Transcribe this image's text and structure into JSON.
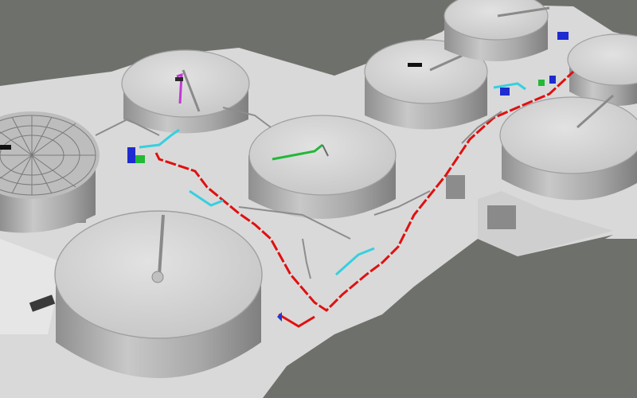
{
  "viewport": {
    "background": "#6e716b",
    "model_fill": "#dcdcdc",
    "tank_wall": "#b8b8b8",
    "tank_top": "#d4d4d4"
  },
  "pipe_colors": {
    "main_pipe": "#e01010",
    "cyan_pipe": "#35d0e0",
    "green_pipe": "#22b838",
    "blue_pipe": "#1e2bd0",
    "magenta_pipe": "#c03ad0"
  }
}
